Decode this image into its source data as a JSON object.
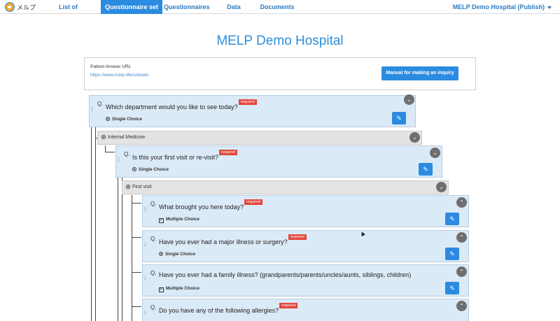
{
  "nav": {
    "brand": "メルプ",
    "tabs": [
      {
        "label": "List of questionnaires"
      },
      {
        "label": "Questionnaire set up"
      },
      {
        "label": "Questionnaires"
      },
      {
        "label": "Data summary"
      },
      {
        "label": "Documents"
      }
    ],
    "active_tab": "Questionnaire set up",
    "hospital_menu": "MELP Demo Hospital (Publish)"
  },
  "page": {
    "title": "MELP Demo Hospital"
  },
  "url_box": {
    "label": "Patient Answer URL",
    "url": "https://www.melp.life/s/dowtn",
    "manual_button": "Manual for making an inquiry"
  },
  "questions": [
    {
      "q": "Q.",
      "text": "Which department would you like to see today?",
      "badge": "required",
      "type": "Single Choice",
      "toggle": "chevron-down"
    },
    {
      "q": "Q.",
      "text": "Is this your first visit or re-visit?",
      "badge": "required",
      "type": "Single Choice",
      "toggle": "chevron-down"
    },
    {
      "q": "Q.",
      "text": "What brought you here today?",
      "badge": "required",
      "type": "Multiple Choice",
      "toggle": "chevron-up"
    },
    {
      "q": "Q.",
      "text": "Have you ever had a major illness or surgery?",
      "badge": "required",
      "type": "Single Choice",
      "toggle": "chevron-up"
    },
    {
      "q": "Q.",
      "text": "Have you ever had a family illness? (grandparents/parents/uncles/aunts, siblings, children)",
      "badge": "",
      "type": "Multiple Choice",
      "toggle": "chevron-up"
    },
    {
      "q": "Q.",
      "text": "Do you have any of the following allergies?",
      "badge": "required",
      "type": "",
      "toggle": "chevron-up"
    }
  ],
  "branches": [
    {
      "label": "Internal Medicine"
    },
    {
      "label": "First visit"
    }
  ],
  "colors": {
    "accent": "#2b8be0",
    "card_bg": "#dbeaf7",
    "branch_bg": "#e3e3e3",
    "required_badge": "#e4453b"
  }
}
